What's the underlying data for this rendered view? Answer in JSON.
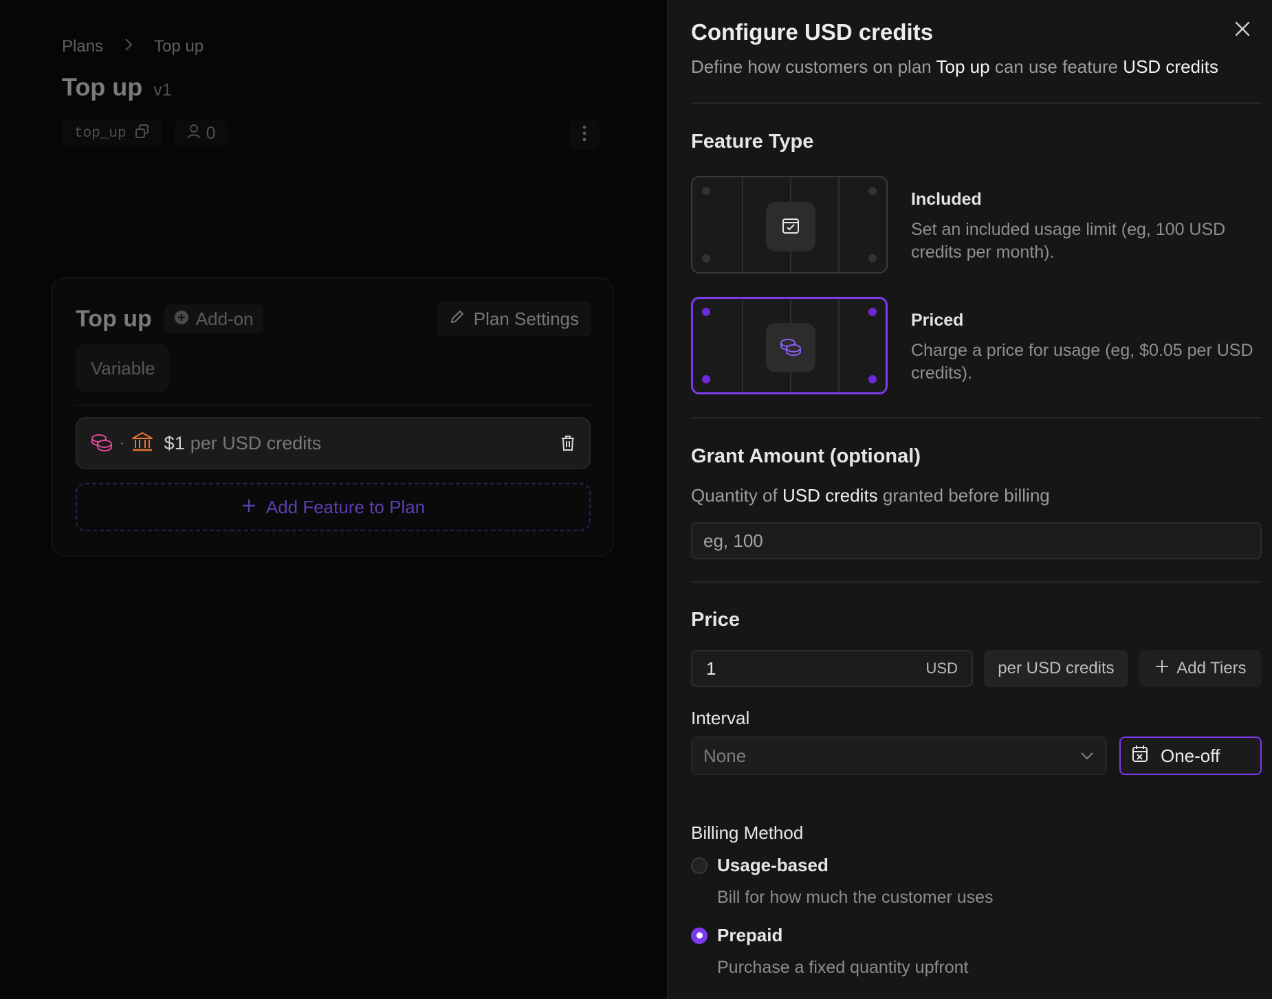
{
  "breadcrumb": {
    "items": [
      "Plans",
      "Top up"
    ],
    "separator": ">"
  },
  "page": {
    "title": "Top up",
    "version": "v1",
    "id": "top_up",
    "users": "0"
  },
  "plan_card": {
    "name": "Top up",
    "badge": "Add-on",
    "settings_label": "Plan Settings",
    "type_badge": "Variable",
    "feature": {
      "price": "$1",
      "unit": "per USD credits",
      "separator": "·"
    },
    "add_feature_label": "Add Feature to Plan"
  },
  "panel": {
    "title": "Configure USD credits",
    "subtitle": {
      "prefix": "Define how customers on plan",
      "plan": "Top up",
      "middle": "can use feature",
      "feature": "USD credits"
    },
    "feature_type": {
      "title": "Feature Type",
      "options": [
        {
          "label": "Included",
          "desc": "Set an included usage limit (eg, 100 USD credits per month)."
        },
        {
          "label": "Priced",
          "desc": "Charge a price for usage (eg, $0.05 per USD credits)."
        }
      ],
      "selected": "Priced"
    },
    "grant": {
      "title": "Grant Amount (optional)",
      "desc": {
        "prefix": "Quantity of",
        "feature": "USD credits",
        "suffix": "granted before billing"
      },
      "placeholder": "eg, 100"
    },
    "price": {
      "title": "Price",
      "value": "1",
      "currency": "USD",
      "per_unit": "per USD credits",
      "add_tiers_label": "Add Tiers"
    },
    "interval": {
      "label": "Interval",
      "value": "None",
      "oneoff_label": "One-off"
    },
    "billing": {
      "label": "Billing Method",
      "options": [
        {
          "label": "Usage-based",
          "desc": "Bill for how much the customer uses",
          "selected": false
        },
        {
          "label": "Prepaid",
          "desc": "Purchase a fixed quantity upfront",
          "selected": true
        }
      ]
    }
  },
  "colors": {
    "accent": "#7c3aed",
    "coin_pink": "#e1489a",
    "bank_orange": "#e8772e",
    "add_feature": "#5b3fb2"
  },
  "icons": [
    "chevron-right-icon",
    "copy-icon",
    "user-icon",
    "kebab-icon",
    "plus-circle-icon",
    "pencil-icon",
    "coins-icon",
    "bank-icon",
    "trash-icon",
    "plus-icon",
    "close-icon",
    "calendar-check-icon",
    "chevron-down-icon",
    "calendar-x-icon"
  ]
}
